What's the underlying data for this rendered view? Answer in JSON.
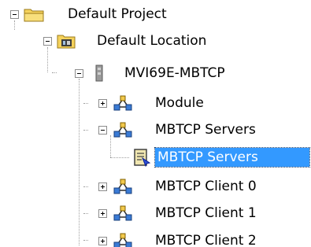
{
  "tree": {
    "root": {
      "label": "Default Project",
      "expanded": true,
      "icon": "folder-icon"
    },
    "location": {
      "label": "Default Location",
      "expanded": true,
      "icon": "location-folder-icon"
    },
    "device": {
      "label": "MVI69E-MBTCP",
      "expanded": true,
      "icon": "module-device-icon"
    },
    "children": [
      {
        "label": "Module",
        "expanded": false,
        "icon": "network-node-icon"
      },
      {
        "label": "MBTCP Servers",
        "expanded": true,
        "icon": "network-node-icon"
      },
      {
        "label": "MBTCP Servers",
        "selected": true,
        "icon": "server-config-icon"
      },
      {
        "label": "MBTCP Client 0",
        "expanded": false,
        "icon": "network-node-icon"
      },
      {
        "label": "MBTCP Client 1",
        "expanded": false,
        "icon": "network-node-icon"
      },
      {
        "label": "MBTCP Client 2",
        "expanded": false,
        "icon": "network-node-icon"
      }
    ]
  },
  "colors": {
    "selection_bg": "#3399ff",
    "selection_text": "#ffffff",
    "folder_yellow": "#f5d25c"
  }
}
